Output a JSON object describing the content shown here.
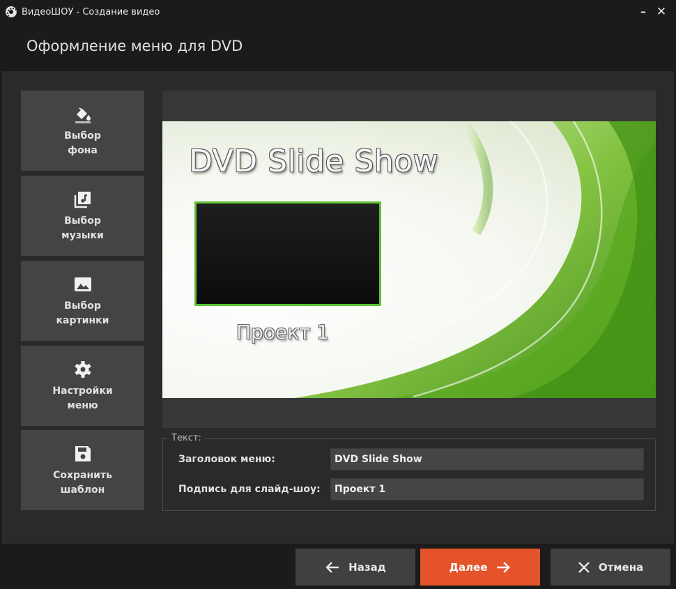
{
  "window": {
    "title": "ВидеоШОУ - Создание видео",
    "minimize": "–",
    "close": "✕"
  },
  "header": {
    "title": "Оформление меню для DVD"
  },
  "sidebar": {
    "items": [
      {
        "label": "Выбор\nфона",
        "icon": "paint-bucket-icon"
      },
      {
        "label": "Выбор\nмузыки",
        "icon": "music-library-icon"
      },
      {
        "label": "Выбор\nкартинки",
        "icon": "image-icon"
      },
      {
        "label": "Настройки\nменю",
        "icon": "gear-icon"
      },
      {
        "label": "Сохранить\nшаблон",
        "icon": "floppy-disk-icon"
      }
    ]
  },
  "preview": {
    "menu_title": "DVD Slide Show",
    "slideshow_caption": "Проект 1",
    "thumb_border_color": "#5cc236"
  },
  "text_group": {
    "legend": "Текст:",
    "fields": [
      {
        "label": "Заголовок меню:",
        "value": "DVD Slide Show"
      },
      {
        "label": "Подпись для слайд-шоу:",
        "value": "Проект 1"
      }
    ]
  },
  "footer": {
    "back_label": "Назад",
    "next_label": "Далее",
    "cancel_label": "Отмена",
    "accent_color": "#e4532a"
  }
}
